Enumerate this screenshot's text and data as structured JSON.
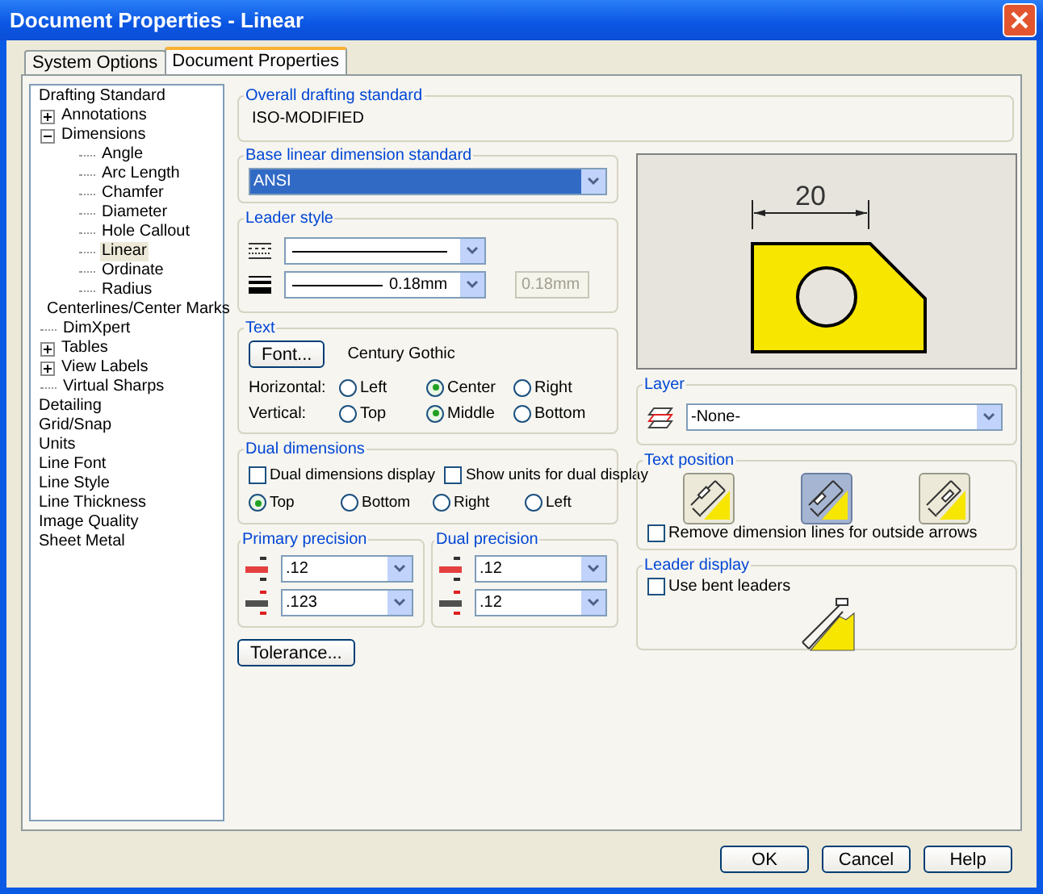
{
  "window": {
    "title": "Document Properties - Linear"
  },
  "tabs": [
    {
      "label": "System Options",
      "selected": false
    },
    {
      "label": "Document Properties",
      "selected": true
    }
  ],
  "tree": [
    {
      "label": "Drafting Standard",
      "selected": false,
      "children": [
        {
          "label": "Annotations",
          "selected": false,
          "expanded": false
        },
        {
          "label": "Dimensions",
          "selected": false,
          "expanded": true,
          "children": [
            {
              "label": "Angle",
              "selected": false
            },
            {
              "label": "Arc Length",
              "selected": false
            },
            {
              "label": "Chamfer",
              "selected": false
            },
            {
              "label": "Diameter",
              "selected": false
            },
            {
              "label": "Hole Callout",
              "selected": false
            },
            {
              "label": "Linear",
              "selected": true
            },
            {
              "label": "Ordinate",
              "selected": false
            },
            {
              "label": "Radius",
              "selected": false
            }
          ]
        },
        {
          "label": "Centerlines/Center Marks",
          "selected": false
        },
        {
          "label": "DimXpert",
          "selected": false
        },
        {
          "label": "Tables",
          "selected": false,
          "expanded": false
        },
        {
          "label": "View Labels",
          "selected": false,
          "expanded": false
        },
        {
          "label": "Virtual Sharps",
          "selected": false
        }
      ]
    },
    {
      "label": "Detailing",
      "selected": false
    },
    {
      "label": "Grid/Snap",
      "selected": false
    },
    {
      "label": "Units",
      "selected": false
    },
    {
      "label": "Line Font",
      "selected": false
    },
    {
      "label": "Line Style",
      "selected": false
    },
    {
      "label": "Line Thickness",
      "selected": false
    },
    {
      "label": "Image Quality",
      "selected": false
    },
    {
      "label": "Sheet Metal",
      "selected": false
    }
  ],
  "overall_drafting_standard": {
    "title": "Overall drafting standard",
    "value": "ISO-MODIFIED"
  },
  "base_linear_dimension_standard": {
    "title": "Base linear dimension standard",
    "value": "ANSI"
  },
  "leader_style": {
    "title": "Leader style",
    "thickness": "0.18mm",
    "custom_thickness": {
      "value": "0.18mm",
      "disabled": true
    }
  },
  "text": {
    "title": "Text",
    "font_button": "Font...",
    "font_name": "Century Gothic",
    "horizontal": {
      "label": "Horizontal:",
      "options": [
        {
          "label": "Left",
          "selected": false
        },
        {
          "label": "Center",
          "selected": true
        },
        {
          "label": "Right",
          "selected": false
        }
      ]
    },
    "vertical": {
      "label": "Vertical:",
      "options": [
        {
          "label": "Top",
          "selected": false
        },
        {
          "label": "Middle",
          "selected": true
        },
        {
          "label": "Bottom",
          "selected": false
        }
      ]
    }
  },
  "dual_dimensions": {
    "title": "Dual dimensions",
    "checkboxes": [
      {
        "label": "Dual dimensions display",
        "checked": false
      },
      {
        "label": "Show units for dual display",
        "checked": false
      }
    ],
    "positions": [
      {
        "label": "Top",
        "selected": true
      },
      {
        "label": "Bottom",
        "selected": false
      },
      {
        "label": "Right",
        "selected": false
      },
      {
        "label": "Left",
        "selected": false
      }
    ]
  },
  "primary_precision": {
    "title": "Primary precision",
    "values": [
      ".12",
      ".123"
    ]
  },
  "dual_precision": {
    "title": "Dual precision",
    "values": [
      ".12",
      ".12"
    ]
  },
  "tolerance_button": "Tolerance...",
  "preview": {
    "dimension": "20"
  },
  "layer": {
    "title": "Layer",
    "value": "-None-"
  },
  "text_position": {
    "title": "Text position",
    "options": [
      {
        "selected": false
      },
      {
        "selected": true
      },
      {
        "selected": false
      }
    ],
    "checkbox": {
      "label": "Remove dimension lines for outside arrows",
      "checked": false
    }
  },
  "leader_display": {
    "title": "Leader display",
    "checkbox": {
      "label": "Use bent leaders",
      "checked": false
    }
  },
  "buttons": [
    "OK",
    "Cancel",
    "Help"
  ]
}
